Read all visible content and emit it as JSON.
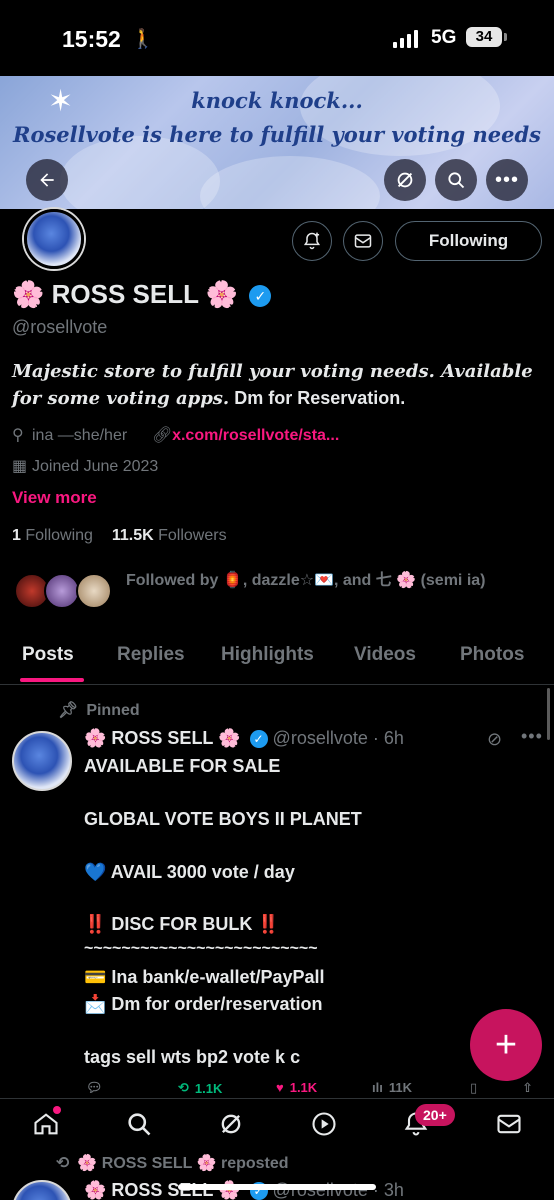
{
  "status_bar": {
    "time": "15:52",
    "network": "5G",
    "battery": "34"
  },
  "banner": {
    "line1": "knock knock...",
    "line2": "Rosellvote is here to fulfill your voting needs"
  },
  "profile_actions": {
    "following_label": "Following"
  },
  "profile": {
    "display_name": "🌸 ROSS SELL 🌸",
    "handle": "@rosellvote",
    "bio_italic": "Majestic store to fulfill your voting needs. Available for some voting apps.",
    "bio_plain": " Dm for Reservation.",
    "location": "ina —she/her",
    "link": "x.com/rosellvote/sta...",
    "joined": "Joined June 2023",
    "view_more": "View more",
    "following_count": "1",
    "following_label": "Following",
    "followers_count": "11.5K",
    "followers_label": "Followers",
    "followed_by": "Followed by 🏮, dazzle☆💌, and 七 🌸 (semi ia)"
  },
  "tabs": [
    "Posts",
    "Replies",
    "Highlights",
    "Videos",
    "Photos"
  ],
  "pinned_post": {
    "pinned_label": "Pinned",
    "author_name": "🌸 ROSS SELL 🌸",
    "author_handle": "@rosellvote · 6h",
    "lines": [
      "AVAILABLE FOR SALE",
      "GLOBAL VOTE  BOYS II PLANET",
      "💙 AVAIL 3000 vote / day",
      "‼️ DISC FOR BULK ‼️",
      "~~~~~~~~~~~~~~~~~~~~~~~~~",
      "💳 Ina bank/e-wallet/PayPall",
      "📩 Dm for order/reservation",
      "tags sell wts bp2 vote k c"
    ],
    "stats": {
      "reposts": "1.1K",
      "likes": "1.1K",
      "views": "11K"
    }
  },
  "nav": {
    "notifications_badge": "20+"
  },
  "next_post": {
    "repost_label": "🌸 ROSS SELL 🌸 reposted",
    "author_name": "🌸 ROSS SELL 🌸",
    "author_handle": "@rosellvote · 3h"
  },
  "colors": {
    "accent": "#f91880",
    "verified": "#1d9bf0",
    "fab": "#c7145e",
    "muted": "#71767b"
  }
}
